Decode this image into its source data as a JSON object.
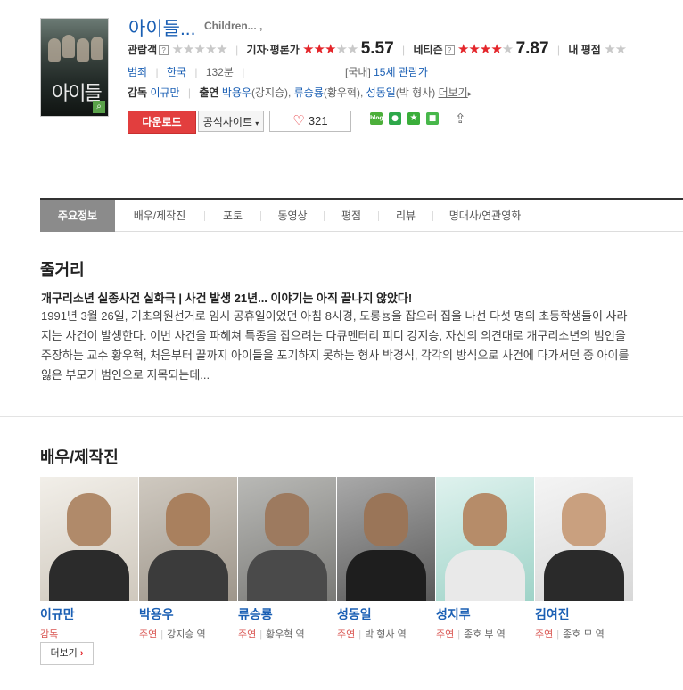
{
  "movie": {
    "title": "아이들...",
    "subtitle": "Children... ,",
    "poster_title": "아이들",
    "audience_label": "관람객",
    "critic_label": "기자·평론가",
    "critic_score": "5.57",
    "netizen_label": "네티즌",
    "netizen_score": "7.87",
    "my_label": "내 평점",
    "genre": "범죄",
    "country": "한국",
    "runtime": "132분",
    "rating_prefix": "[국내]",
    "rating": "15세 관람가",
    "director_label": "감독",
    "director": "이규만",
    "cast_label": "출연",
    "cast_1": "박용우",
    "cast_1_role": "(강지승),",
    "cast_2": "류승룡",
    "cast_2_role": "(황우혁),",
    "cast_3": "성동일",
    "cast_3_role": "(박 형사)",
    "more_link": "더보기"
  },
  "ratings": {
    "audience_stars": 0,
    "critic_stars": 2.8,
    "netizen_stars": 3.9
  },
  "actions": {
    "download": "다운로드",
    "official_site": "공식사이트",
    "likes": "321"
  },
  "sns": {
    "blog": "blog"
  },
  "tabs": [
    "주요정보",
    "배우/제작진",
    "포토",
    "동영상",
    "평점",
    "리뷰",
    "명대사/연관영화"
  ],
  "synopsis": {
    "heading": "줄거리",
    "tagline": "개구리소년 실종사건 실화극 | 사건 발생 21년... 이야기는 아직 끝나지 않았다!",
    "body": "1991년 3월 26일, 기초의원선거로 임시 공휴일이었던 아침 8시경, 도롱뇽을 잡으러 집을 나선 다섯 명의 초등학생들이 사라지는 사건이 발생한다. 이번 사건을 파헤쳐 특종을 잡으려는 다큐멘터리 피디 강지승, 자신의 의견대로 개구리소년의 범인을 주장하는 교수 황우혁, 처음부터 끝까지 아이들을 포기하지 못하는 형사 박경식, 각각의 방식으로 사건에 다가서던 중 아이를 잃은 부모가 범인으로 지목되는데..."
  },
  "crew": {
    "heading": "배우/제작진",
    "more": "더보기",
    "people": [
      {
        "name": "이규만",
        "role": "감독",
        "character": ""
      },
      {
        "name": "박용우",
        "role": "주연",
        "character": "강지승 역"
      },
      {
        "name": "류승룡",
        "role": "주연",
        "character": "황우혁 역"
      },
      {
        "name": "성동일",
        "role": "주연",
        "character": "박 형사 역"
      },
      {
        "name": "성지루",
        "role": "주연",
        "character": "종호 부 역"
      },
      {
        "name": "김여진",
        "role": "주연",
        "character": "종호 모 역"
      }
    ]
  },
  "colors": {
    "accent_blue": "#1a5fb4",
    "star_red": "#e4262b",
    "download_red": "#e23e3e"
  }
}
